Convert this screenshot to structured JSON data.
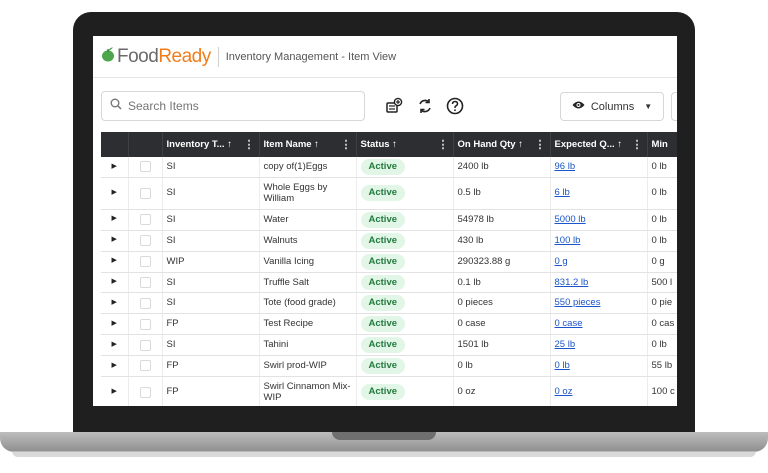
{
  "app": {
    "logo_food": "Food",
    "logo_ready": "Ready",
    "page_title": "Inventory Management - Item View"
  },
  "toolbar": {
    "search_placeholder": "Search Items",
    "columns_label": "Columns"
  },
  "table": {
    "headers": {
      "inventory_type": "Inventory T... ↑",
      "item_name": "Item Name ↑",
      "status": "Status ↑",
      "on_hand_qty": "On Hand Qty ↑",
      "expected_qty": "Expected Q... ↑",
      "min": "Min"
    },
    "rows": [
      {
        "type": "SI",
        "name": "copy of(1)Eggs",
        "status": "Active",
        "on_hand": "2400 lb",
        "expected": "96 lb",
        "min": "0 lb"
      },
      {
        "type": "SI",
        "name": "Whole Eggs by William",
        "status": "Active",
        "on_hand": "0.5 lb",
        "expected": "6 lb",
        "min": "0 lb"
      },
      {
        "type": "SI",
        "name": "Water",
        "status": "Active",
        "on_hand": "54978 lb",
        "expected": "5000 lb",
        "min": "0 lb"
      },
      {
        "type": "SI",
        "name": "Walnuts",
        "status": "Active",
        "on_hand": "430 lb",
        "expected": "100 lb",
        "min": "0 lb"
      },
      {
        "type": "WIP",
        "name": "Vanilla Icing",
        "status": "Active",
        "on_hand": "290323.88 g",
        "expected": "0 g",
        "min": "0 g"
      },
      {
        "type": "SI",
        "name": "Truffle Salt",
        "status": "Active",
        "on_hand": "0.1 lb",
        "expected": "831.2 lb",
        "min": "500 l"
      },
      {
        "type": "SI",
        "name": "Tote (food grade)",
        "status": "Active",
        "on_hand": "0 pieces",
        "expected": "550 pieces",
        "min": "0 pie"
      },
      {
        "type": "FP",
        "name": "Test Recipe",
        "status": "Active",
        "on_hand": "0 case",
        "expected": "0 case",
        "min": "0 cas"
      },
      {
        "type": "SI",
        "name": "Tahini",
        "status": "Active",
        "on_hand": "1501 lb",
        "expected": "25 lb",
        "min": "0 lb"
      },
      {
        "type": "FP",
        "name": "Swirl prod-WIP",
        "status": "Active",
        "on_hand": "0 lb",
        "expected": "0 lb",
        "min": "55 lb"
      },
      {
        "type": "FP",
        "name": "Swirl Cinnamon Mix-WIP",
        "status": "Active",
        "on_hand": "0 oz",
        "expected": "0 oz",
        "min": "100 c"
      }
    ]
  },
  "colors": {
    "header_bg": "#2c2e32",
    "accent_orange": "#f07d1a",
    "status_green": "#227a3d",
    "link_blue": "#1a55c9"
  },
  "icons": [
    "search-icon",
    "export-icon",
    "refresh-icon",
    "help-icon",
    "eye-icon",
    "caret-down-icon",
    "logo-icon",
    "expand-row-icon",
    "column-menu-icon"
  ]
}
